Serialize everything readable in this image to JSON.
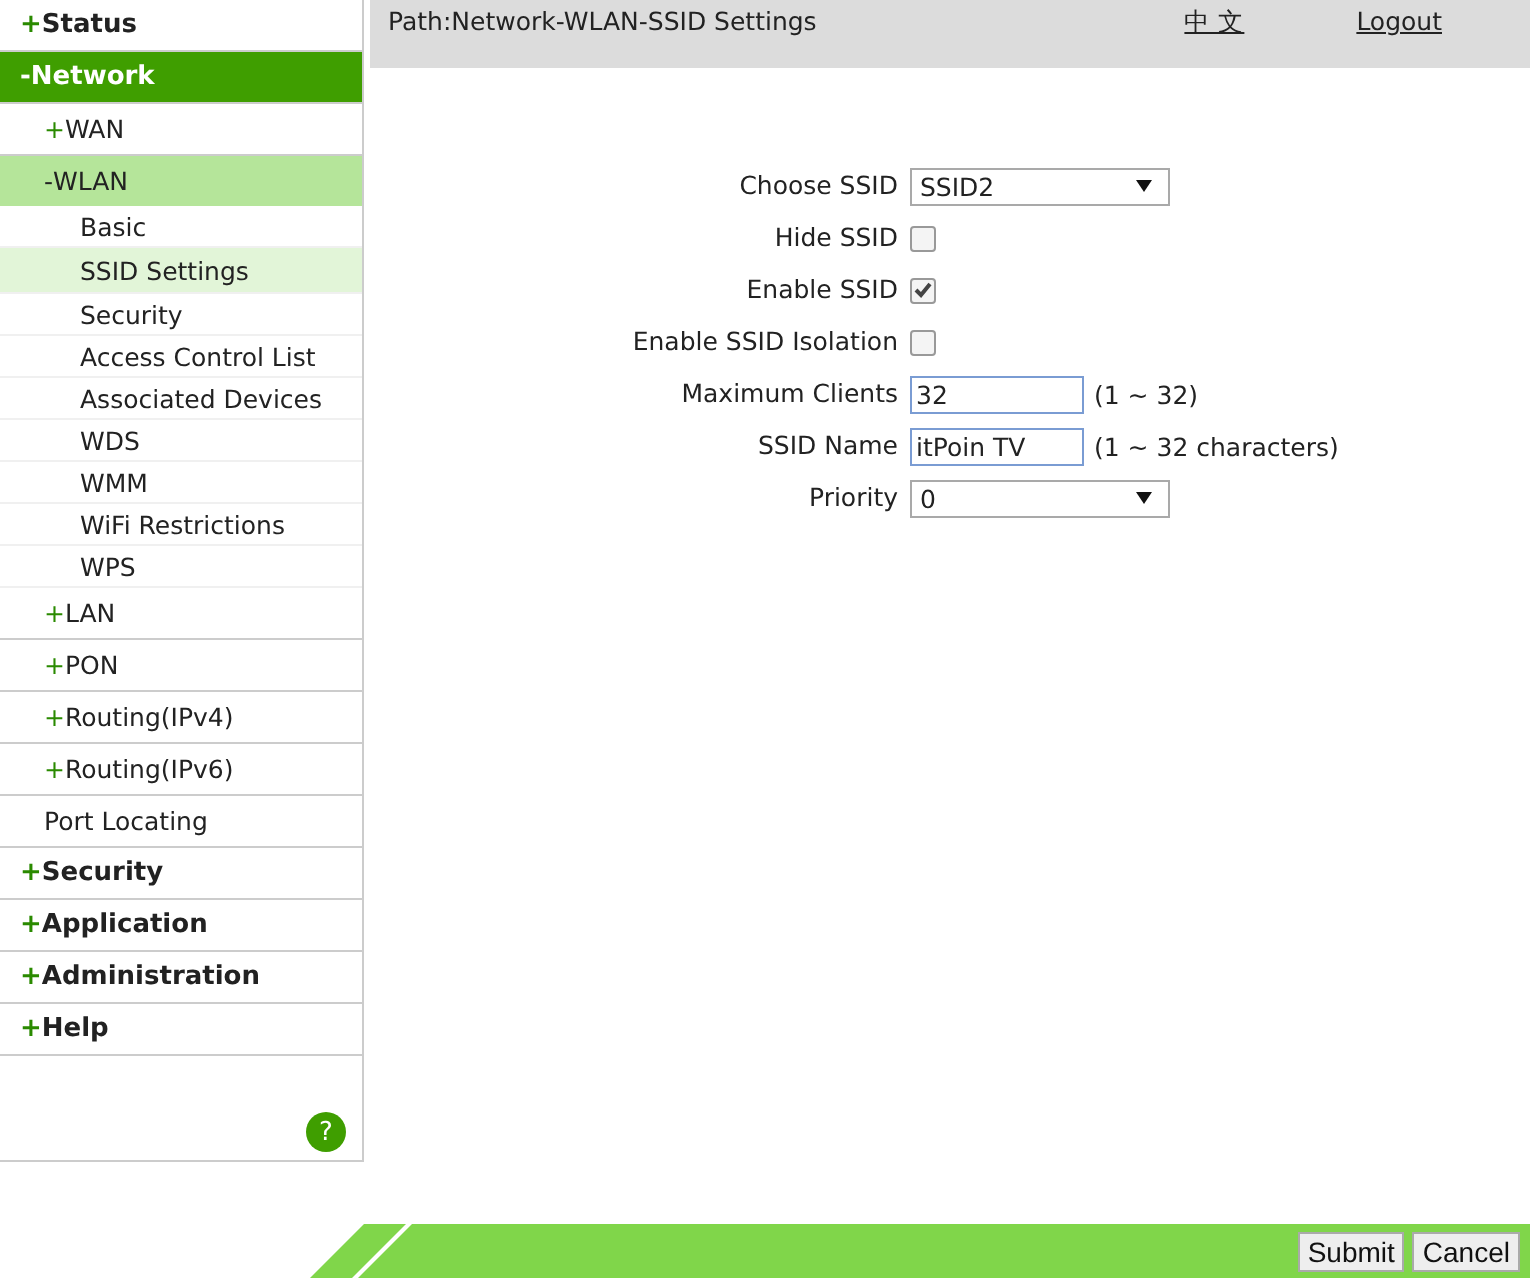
{
  "sidebar": {
    "items": [
      {
        "marker": "+",
        "label": "Status",
        "selected": false
      },
      {
        "marker": "-",
        "label": "Network",
        "selected": true,
        "children": [
          {
            "marker": "+",
            "label": "WAN",
            "selected": false
          },
          {
            "marker": "-",
            "label": "WLAN",
            "selected": true,
            "children": [
              {
                "label": "Basic",
                "selected": false
              },
              {
                "label": "SSID Settings",
                "selected": true
              },
              {
                "label": "Security",
                "selected": false
              },
              {
                "label": "Access Control List",
                "selected": false
              },
              {
                "label": "Associated Devices",
                "selected": false
              },
              {
                "label": "WDS",
                "selected": false
              },
              {
                "label": "WMM",
                "selected": false
              },
              {
                "label": "WiFi Restrictions",
                "selected": false
              },
              {
                "label": "WPS",
                "selected": false
              }
            ]
          },
          {
            "marker": "+",
            "label": "LAN",
            "selected": false
          },
          {
            "marker": "+",
            "label": "PON",
            "selected": false
          },
          {
            "marker": "+",
            "label": "Routing(IPv4)",
            "selected": false
          },
          {
            "marker": "+",
            "label": "Routing(IPv6)",
            "selected": false
          },
          {
            "label": "Port Locating",
            "selected": false
          }
        ]
      },
      {
        "marker": "+",
        "label": "Security",
        "selected": false
      },
      {
        "marker": "+",
        "label": "Application",
        "selected": false
      },
      {
        "marker": "+",
        "label": "Administration",
        "selected": false
      },
      {
        "marker": "+",
        "label": "Help",
        "selected": false
      }
    ],
    "help_button": "?"
  },
  "header": {
    "path": "Path:Network-WLAN-SSID Settings",
    "language_link": "中 文",
    "logout_link": "Logout"
  },
  "form": [
    {
      "kind": "select",
      "label": "Choose SSID",
      "value": "SSID2"
    },
    {
      "kind": "checkbox",
      "label": "Hide SSID",
      "checked": false
    },
    {
      "kind": "checkbox",
      "label": "Enable SSID",
      "checked": true
    },
    {
      "kind": "checkbox",
      "label": "Enable SSID Isolation",
      "checked": false
    },
    {
      "kind": "text",
      "label": "Maximum Clients",
      "value": "32",
      "hint": "(1 ~ 32)"
    },
    {
      "kind": "text",
      "label": "SSID Name",
      "value": "itPoin TV",
      "hint": "(1 ~ 32 characters)"
    },
    {
      "kind": "select",
      "label": "Priority",
      "value": "0"
    }
  ],
  "buttons": [
    "Submit",
    "Cancel"
  ]
}
